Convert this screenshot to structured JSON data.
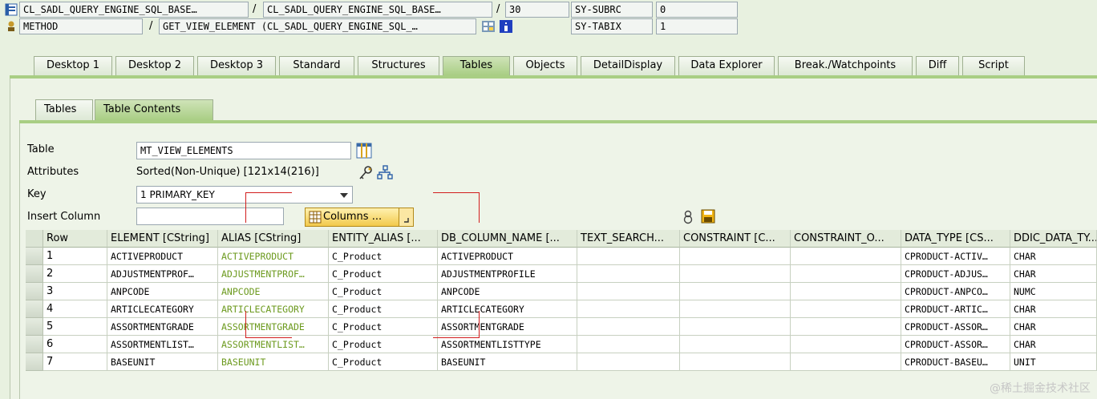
{
  "header": {
    "row1": {
      "field1": "CL_SADL_QUERY_ENGINE_SQL_BASE…",
      "field2": "CL_SADL_QUERY_ENGINE_SQL_BASE…",
      "line": "30",
      "var_name": "SY-SUBRC",
      "var_value": "0"
    },
    "row2": {
      "kind": "METHOD",
      "method": "GET_VIEW_ELEMENT (CL_SADL_QUERY_ENGINE_SQL_…",
      "var_name": "SY-TABIX",
      "var_value": "1"
    },
    "separator": "/"
  },
  "tabs": [
    "Desktop 1",
    "Desktop 2",
    "Desktop 3",
    "Standard",
    "Structures",
    "Tables",
    "Objects",
    "DetailDisplay",
    "Data Explorer",
    "Break./Watchpoints",
    "Diff",
    "Script"
  ],
  "subtabs": [
    "Tables",
    "Table Contents"
  ],
  "form": {
    "table_label": "Table",
    "table_value": "MT_VIEW_ELEMENTS",
    "attributes_label": "Attributes",
    "attributes_value": "Sorted(Non-Unique) [121x14(216)]",
    "key_label": "Key",
    "key_value": "1 PRIMARY_KEY",
    "insert_label": "Insert Column",
    "insert_value": "",
    "columns_button": "Columns ..."
  },
  "grid": {
    "headers": [
      "Row",
      "ELEMENT [CString]",
      "ALIAS [CString]",
      "ENTITY_ALIAS [...",
      "DB_COLUMN_NAME [...",
      "TEXT_SEARCH...",
      "CONSTRAINT [C...",
      "CONSTRAINT_O...",
      "DATA_TYPE [CS...",
      "DDIC_DATA_TY..."
    ],
    "rows": [
      [
        "1",
        "ACTIVEPRODUCT",
        "ACTIVEPRODUCT",
        "C_Product",
        "ACTIVEPRODUCT",
        "",
        "",
        "",
        "CPRODUCT-ACTIV…",
        "CHAR"
      ],
      [
        "2",
        "ADJUSTMENTPROF…",
        "ADJUSTMENTPROF…",
        "C_Product",
        "ADJUSTMENTPROFILE",
        "",
        "",
        "",
        "CPRODUCT-ADJUS…",
        "CHAR"
      ],
      [
        "3",
        "ANPCODE",
        "ANPCODE",
        "C_Product",
        "ANPCODE",
        "",
        "",
        "",
        "CPRODUCT-ANPCO…",
        "NUMC"
      ],
      [
        "4",
        "ARTICLECATEGORY",
        "ARTICLECATEGORY",
        "C_Product",
        "ARTICLECATEGORY",
        "",
        "",
        "",
        "CPRODUCT-ARTIC…",
        "CHAR"
      ],
      [
        "5",
        "ASSORTMENTGRADE",
        "ASSORTMENTGRADE",
        "C_Product",
        "ASSORTMENTGRADE",
        "",
        "",
        "",
        "CPRODUCT-ASSOR…",
        "CHAR"
      ],
      [
        "6",
        "ASSORTMENTLIST…",
        "ASSORTMENTLIST…",
        "C_Product",
        "ASSORTMENTLISTTYPE",
        "",
        "",
        "",
        "CPRODUCT-ASSOR…",
        "CHAR"
      ],
      [
        "7",
        "BASEUNIT",
        "BASEUNIT",
        "C_Product",
        "BASEUNIT",
        "",
        "",
        "",
        "CPRODUCT-BASEU…",
        "UNIT"
      ]
    ]
  },
  "watermark": "@稀土掘金技术社区",
  "colors": {
    "alias_text": "#6c9a1e",
    "tab_active": "#a9ce84",
    "annotation": "#d21d1d"
  },
  "icons": [
    "program-icon",
    "method-icon",
    "navigate-icon",
    "info-icon",
    "table-icon",
    "key-icon",
    "structure-icon",
    "columns-icon",
    "dropdown-arrow-icon",
    "filter-icon",
    "save-icon"
  ]
}
